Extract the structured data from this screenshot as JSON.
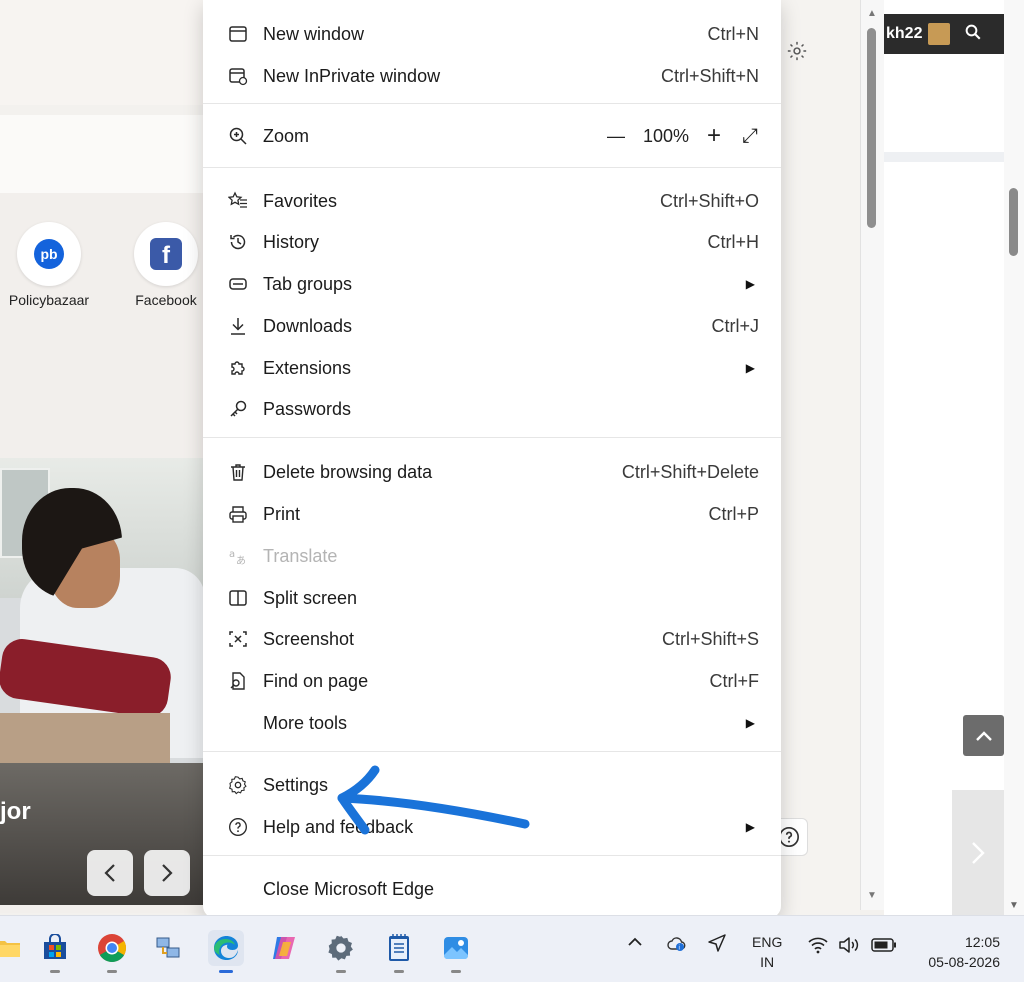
{
  "background": {
    "shortcuts": [
      {
        "label": "Policybazaar",
        "logo_text": "pb"
      },
      {
        "label": "Facebook",
        "logo_text": "f"
      }
    ],
    "hero_caption": "jor",
    "right_window_text": "kh22"
  },
  "menu": {
    "new_window": {
      "label": "New window",
      "shortcut": "Ctrl+N"
    },
    "new_inprivate": {
      "label": "New InPrivate window",
      "shortcut": "Ctrl+Shift+N"
    },
    "zoom": {
      "label": "Zoom",
      "minus": "—",
      "value": "100%",
      "plus": "+",
      "expand": "⤢"
    },
    "favorites": {
      "label": "Favorites",
      "shortcut": "Ctrl+Shift+O"
    },
    "history": {
      "label": "History",
      "shortcut": "Ctrl+H"
    },
    "tab_groups": {
      "label": "Tab groups"
    },
    "downloads": {
      "label": "Downloads",
      "shortcut": "Ctrl+J"
    },
    "extensions": {
      "label": "Extensions"
    },
    "passwords": {
      "label": "Passwords"
    },
    "delete_browsing_data": {
      "label": "Delete browsing data",
      "shortcut": "Ctrl+Shift+Delete"
    },
    "print": {
      "label": "Print",
      "shortcut": "Ctrl+P"
    },
    "translate": {
      "label": "Translate"
    },
    "split_screen": {
      "label": "Split screen"
    },
    "screenshot": {
      "label": "Screenshot",
      "shortcut": "Ctrl+Shift+S"
    },
    "find_on_page": {
      "label": "Find on page",
      "shortcut": "Ctrl+F"
    },
    "more_tools": {
      "label": "More tools"
    },
    "settings": {
      "label": "Settings"
    },
    "help_feedback": {
      "label": "Help and feedback"
    },
    "close_edge": {
      "label": "Close Microsoft Edge"
    },
    "submenu_arrow": "▶"
  },
  "annotation": {
    "color": "#1a73d9"
  },
  "taskbar": {
    "language": {
      "line1": "ENG",
      "line2": "IN"
    },
    "time": "12:05",
    "date": "05-08-2026",
    "apps": [
      "file-explorer",
      "microsoft-store",
      "chrome",
      "network-app",
      "edge",
      "copilot",
      "settings",
      "notepad",
      "photos"
    ]
  },
  "colors": {
    "accent": "#2a6ad8",
    "menu_bg": "#ffffff",
    "separator": "#e6e6e6"
  }
}
